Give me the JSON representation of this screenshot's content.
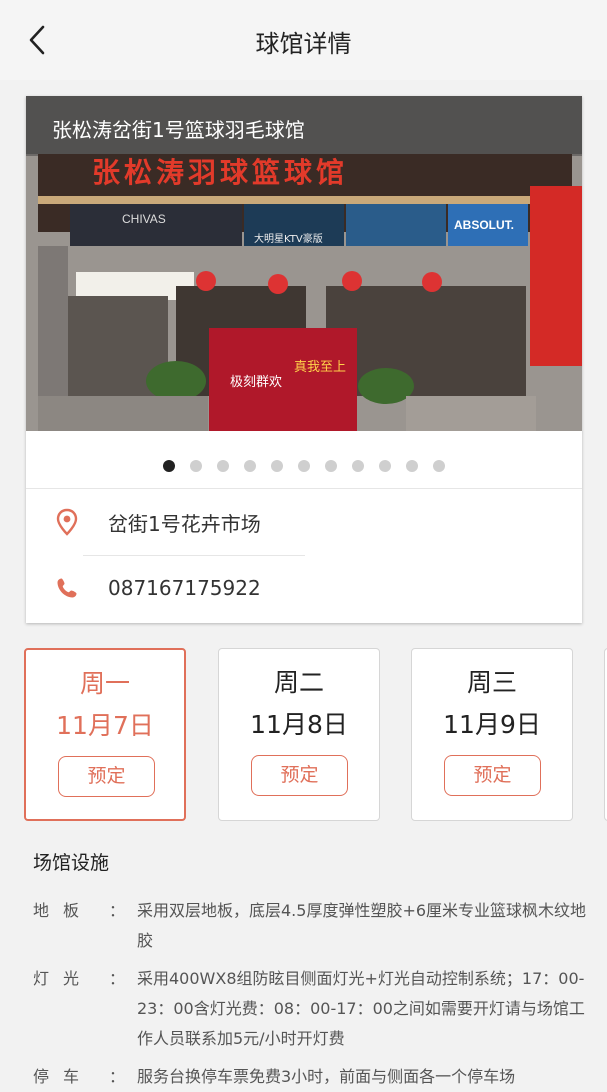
{
  "header": {
    "title": "球馆详情"
  },
  "venue": {
    "photo_caption": "张松涛岔街1号篮球羽毛球馆",
    "sign_text": "张松涛羽球篮球馆",
    "poster_text_left": "极刻群欢",
    "poster_text_right": "真我至上",
    "ad_brand": "ABSOLUT.",
    "ad_chivas": "CHIVAS",
    "ad_ktv": "大明星KTV豪版",
    "slides_total": 11,
    "slide_active": 1,
    "address": "岔街1号花卉市场",
    "phone": "087167175922"
  },
  "days": [
    {
      "weekday": "周一",
      "date": "11月7日",
      "book_label": "预定",
      "active": true
    },
    {
      "weekday": "周二",
      "date": "11月8日",
      "book_label": "预定",
      "active": false
    },
    {
      "weekday": "周三",
      "date": "11月9日",
      "book_label": "预定",
      "active": false
    }
  ],
  "facilities": {
    "title": "场馆设施",
    "items": [
      {
        "key": "地板",
        "colon": "：",
        "value": "采用双层地板，底层4.5厚度弹性塑胶+6厘米专业篮球枫木纹地胶"
      },
      {
        "key": "灯光",
        "colon": "：",
        "value": "采用400WX8组防眩目侧面灯光+灯光自动控制系统；17：00-23：00含灯光费：08：00-17：00之间如需要开灯请与场馆工作人员联系加5元/小时开灯费"
      },
      {
        "key": "停车",
        "colon": "：",
        "value": "服务台换停车票免费3小时，前面与侧面各一个停车场"
      }
    ]
  },
  "colors": {
    "accent": "#e0705a",
    "text": "#222222",
    "muted": "#555555"
  },
  "icons": {
    "back": "chevron-left-icon",
    "location": "location-pin-icon",
    "phone": "phone-icon"
  }
}
